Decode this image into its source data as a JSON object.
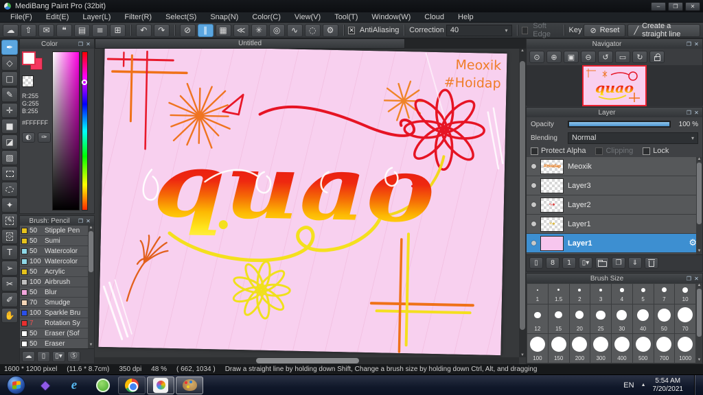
{
  "chrome": {
    "popup": "❐",
    "close": "✕"
  },
  "window": {
    "title": "MediBang Paint Pro (32bit)",
    "minimize": "–",
    "restore": "❐",
    "close": "✕"
  },
  "menu": {
    "items": [
      "File(F)",
      "Edit(E)",
      "Layer(L)",
      "Filter(R)",
      "Select(S)",
      "Snap(N)",
      "Color(C)",
      "View(V)",
      "Tool(T)",
      "Window(W)",
      "Cloud",
      "Help"
    ]
  },
  "toolbar": {
    "file_icons": [
      {
        "name": "cloud-icon",
        "glyph": "☁"
      },
      {
        "name": "publish-icon",
        "glyph": "⇧"
      },
      {
        "name": "comment-icon",
        "glyph": "✉"
      },
      {
        "name": "comment-list-icon",
        "glyph": "❝"
      },
      {
        "name": "document-icon",
        "glyph": "▤"
      },
      {
        "name": "material-panel-icon",
        "glyph": "≡"
      },
      {
        "name": "window-tile-icon",
        "glyph": "⊞"
      }
    ],
    "history_icons": [
      {
        "name": "undo-icon",
        "glyph": "↶"
      },
      {
        "name": "redo-icon",
        "glyph": "↷"
      }
    ],
    "snap_icons": [
      {
        "name": "snap-off-icon",
        "glyph": "⊘"
      },
      {
        "name": "snap-parallel-icon",
        "glyph": "∥",
        "active": true
      },
      {
        "name": "snap-grid-icon",
        "glyph": "▦"
      },
      {
        "name": "snap-vanishing-icon",
        "glyph": "≪"
      },
      {
        "name": "snap-radial-icon",
        "glyph": "✳"
      },
      {
        "name": "snap-concentric-icon",
        "glyph": "◎"
      },
      {
        "name": "snap-curve-icon",
        "glyph": "∿"
      },
      {
        "name": "snap-ellipse-icon",
        "glyph": "◌"
      },
      {
        "name": "snap-settings-icon",
        "glyph": "⚙"
      }
    ],
    "antialiasing_label": "AntiAliasing",
    "antialiasing_check": "✕",
    "correction_label": "Correction",
    "correction_value": "40",
    "soft_edge_label": "Soft Edge",
    "key_label": "Key",
    "reset_icon": "⊘",
    "reset_label": "Reset",
    "straight_line_icon": "╱",
    "straight_line_label": "Create a straight line"
  },
  "tools": {
    "items": [
      {
        "name": "brush-tool",
        "glyph": "✒",
        "selected": true
      },
      {
        "name": "eraser-tool",
        "glyph": "◇"
      },
      {
        "name": "dot-tool",
        "glyph": "□"
      },
      {
        "name": "polyline-tool",
        "glyph": "✎"
      },
      {
        "name": "move-tool",
        "glyph": "✛"
      },
      {
        "name": "fill-rect-tool",
        "glyph": "■"
      },
      {
        "name": "bucket-tool",
        "glyph": "◪"
      },
      {
        "name": "gradient-tool",
        "glyph": "▨"
      },
      {
        "name": "select-tool",
        "glyph": "",
        "cls": "dashed-rect"
      },
      {
        "name": "lasso-tool",
        "glyph": "",
        "cls": "dashed-oval"
      },
      {
        "name": "magic-wand-tool",
        "glyph": "✦"
      },
      {
        "name": "select-pen-tool",
        "glyph": "✎",
        "cls": "dash-border"
      },
      {
        "name": "select-eraser-tool",
        "glyph": "◇",
        "cls": "dash-border"
      },
      {
        "name": "text-tool",
        "glyph": "T"
      },
      {
        "name": "operation-tool",
        "glyph": "➢"
      },
      {
        "name": "divide-tool",
        "glyph": "✂"
      },
      {
        "name": "eyedropper-tool",
        "glyph": "✐"
      },
      {
        "name": "hand-tool",
        "glyph": "✋"
      }
    ]
  },
  "color_panel": {
    "title": "Color",
    "r": "R:255",
    "g": "G:255",
    "b": "B:255",
    "hex": "#FFFFFF",
    "fg_color": "#ffffff",
    "bg_color": "#f5365f",
    "palette_icon": "◐",
    "picker_icon": "✑"
  },
  "brush_panel": {
    "title": "Brush: Pencil",
    "brushes": [
      {
        "size": "50",
        "name": "Stipple Pen",
        "swatch": "#e7c31c"
      },
      {
        "size": "50",
        "name": "Sumi",
        "swatch": "#e7c31c"
      },
      {
        "size": "50",
        "name": "Watercolor",
        "swatch": "#8fd8e8"
      },
      {
        "size": "100",
        "name": "Watercolor",
        "swatch": "#8fd8e8"
      },
      {
        "size": "50",
        "name": "Acrylic",
        "swatch": "#e7c31c"
      },
      {
        "size": "100",
        "name": "Airbrush",
        "swatch": "#c0c0c0"
      },
      {
        "size": "50",
        "name": "Blur",
        "swatch": "#f2a6dd"
      },
      {
        "size": "70",
        "name": "Smudge",
        "swatch": "#f5d7b8"
      },
      {
        "size": "100",
        "name": "Sparkle Bru",
        "swatch": "#2b50e8"
      },
      {
        "size": "7",
        "name": "Rotation Sy",
        "swatch": "#e83030",
        "size_red": true
      },
      {
        "size": "50",
        "name": "Eraser (Sof",
        "swatch": "#ffffff"
      },
      {
        "size": "50",
        "name": "Eraser",
        "swatch": "#ffffff"
      }
    ],
    "footer_icons": [
      {
        "name": "cloud-brush-icon",
        "glyph": "☁"
      },
      {
        "name": "new-brush-icon",
        "glyph": "▯"
      },
      {
        "name": "brush-menu-icon",
        "glyph": "▯▾"
      },
      {
        "name": "script-brush-icon",
        "glyph": "Ⓢ"
      }
    ]
  },
  "canvas": {
    "tab": "Untitled",
    "word": "quao",
    "signature": "Meoxik",
    "hashtag": "#Hoidap"
  },
  "navigator": {
    "title": "Navigator",
    "icons": [
      {
        "name": "zoom-actual-icon",
        "glyph": "⊙"
      },
      {
        "name": "zoom-in-icon",
        "glyph": "⊕"
      },
      {
        "name": "fit-screen-icon",
        "glyph": "▣"
      },
      {
        "name": "zoom-out-icon",
        "glyph": "⊖"
      },
      {
        "name": "rotate-left-icon",
        "glyph": "↺"
      },
      {
        "name": "reset-rotation-icon",
        "glyph": "▭"
      },
      {
        "name": "rotate-right-icon",
        "glyph": "↻"
      },
      {
        "name": "lock-icon",
        "glyph": "",
        "cls": "i-lock"
      }
    ]
  },
  "layer_panel": {
    "title": "Layer",
    "opacity_label": "Opacity",
    "opacity_value": "100 %",
    "blending_label": "Blending",
    "blending_value": "Normal",
    "protect_alpha_label": "Protect Alpha",
    "clipping_label": "Clipping",
    "lock_label": "Lock",
    "layers": [
      {
        "name": "Meoxik",
        "mark": "#Hoidap",
        "mark_color": "#e8832a"
      },
      {
        "name": "Layer3"
      },
      {
        "name": "Layer2",
        "mark": "∿∗",
        "mark_color": "#e03030"
      },
      {
        "name": "Layer1",
        "mark": "✳∗",
        "mark_color": "#e0b82a"
      },
      {
        "name": "Layer1",
        "selected": true,
        "pink": true,
        "gear": "⚙"
      }
    ],
    "footer_icons": [
      {
        "name": "add-layer-icon",
        "glyph": "▯"
      },
      {
        "name": "add-8bit-layer-icon",
        "glyph": "8"
      },
      {
        "name": "add-1bit-layer-icon",
        "glyph": "1"
      },
      {
        "name": "add-layer-menu-icon",
        "glyph": "▯▾"
      },
      {
        "name": "folder-icon",
        "glyph": "",
        "cls": "i-folder"
      },
      {
        "name": "duplicate-layer-icon",
        "glyph": "❐"
      },
      {
        "name": "transfer-layer-icon",
        "glyph": "⇓"
      },
      {
        "name": "delete-layer-icon",
        "glyph": "",
        "cls": "i-trash"
      }
    ]
  },
  "brush_size_panel": {
    "title": "Brush Size",
    "sizes": [
      "1",
      "1.5",
      "2",
      "3",
      "4",
      "5",
      "7",
      "10",
      "12",
      "15",
      "20",
      "25",
      "30",
      "40",
      "50",
      "70",
      "100",
      "150",
      "200",
      "300",
      "400",
      "500",
      "700",
      "1000"
    ]
  },
  "status_bar": {
    "dimensions": "1600 * 1200 pixel",
    "physical": "(11.6 * 8.7cm)",
    "dpi": "350 dpi",
    "zoom": "48 %",
    "coords": "( 662, 1034 )",
    "hint": "Draw a straight line by holding down Shift, Change a brush size by holding down Ctrl, Alt, and dragging"
  },
  "taskbar": {
    "lang": "EN",
    "tray_arrow": "▲",
    "time": "5:54 AM",
    "date": "7/20/2021"
  }
}
